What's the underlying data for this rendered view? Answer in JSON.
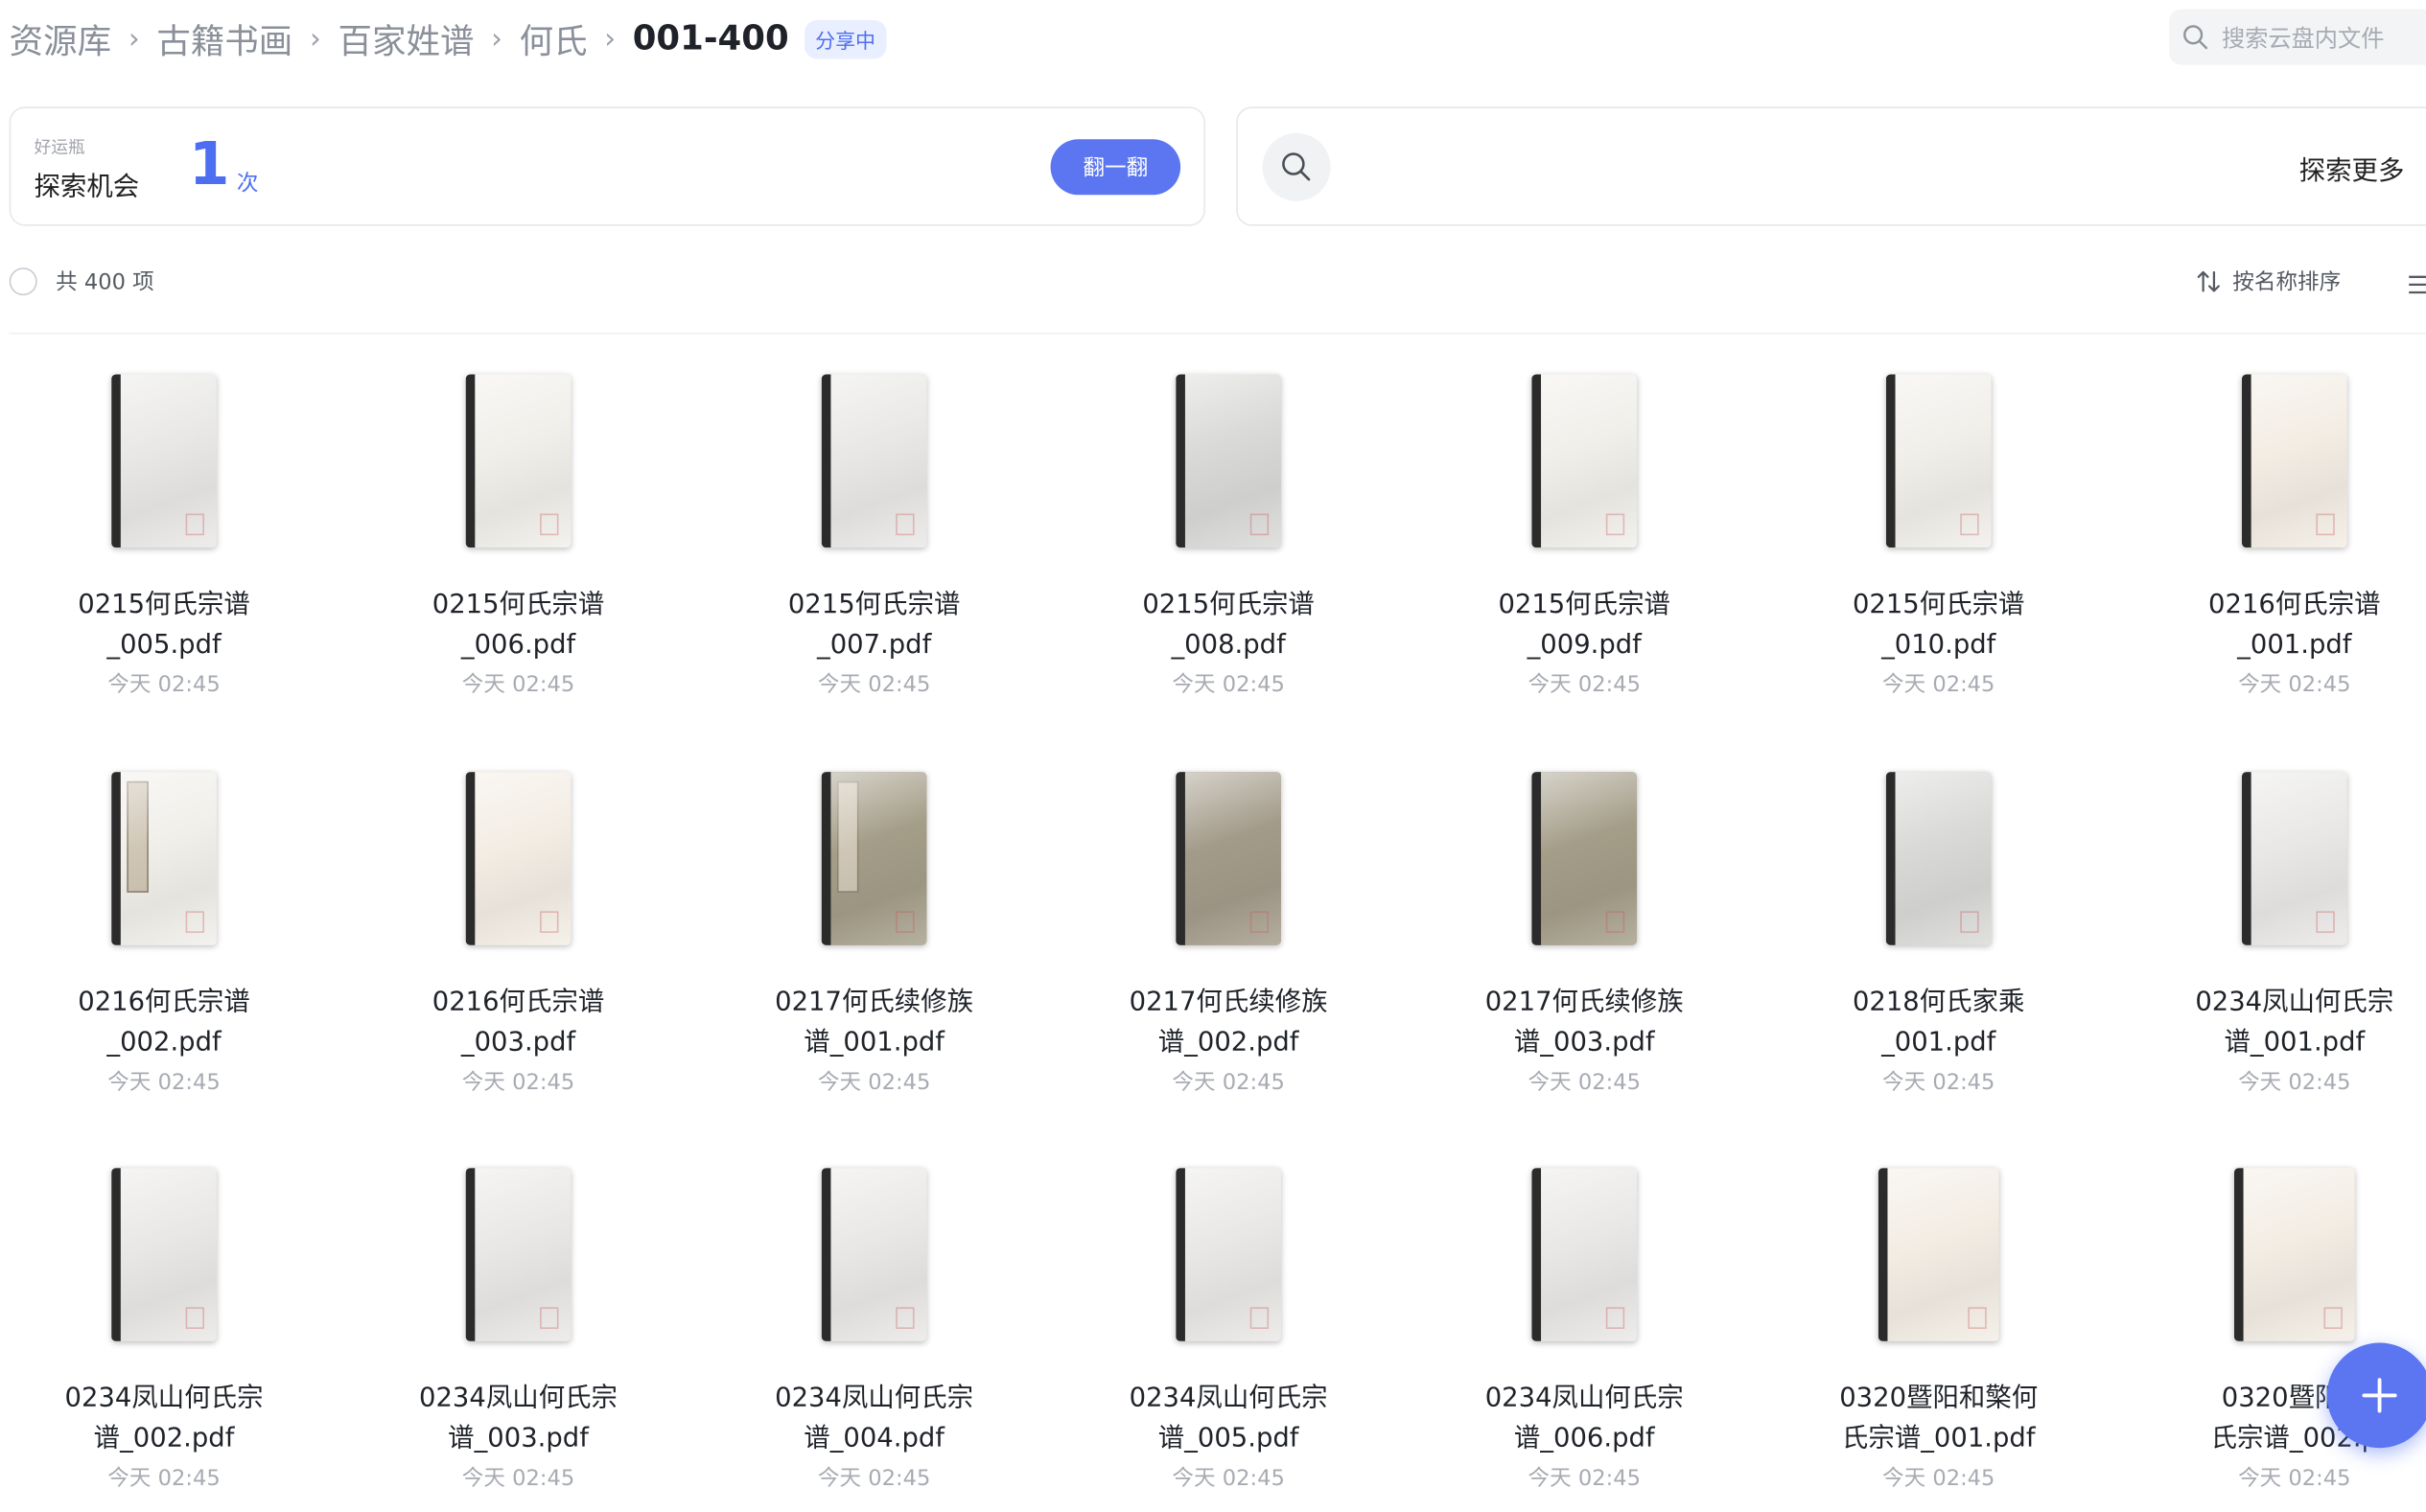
{
  "breadcrumb": {
    "items": [
      "资源库",
      "古籍书画",
      "百家姓谱",
      "何氏"
    ],
    "current": "001-400",
    "badge": "分享中",
    "separator": "›"
  },
  "search": {
    "placeholder": "搜索云盘内文件"
  },
  "lucky_card": {
    "small_label": "好运瓶",
    "label": "探索机会",
    "count": "1",
    "unit": "次",
    "button_label": "翻一翻"
  },
  "explore_card": {
    "label": "探索更多"
  },
  "list_header": {
    "count_text": "共 400 项",
    "sort_label": "按名称排序"
  },
  "files": [
    {
      "line1": "0215何氏宗谱",
      "line2": "_005.pdf",
      "date": "今天 02:45"
    },
    {
      "line1": "0215何氏宗谱",
      "line2": "_006.pdf",
      "date": "今天 02:45"
    },
    {
      "line1": "0215何氏宗谱",
      "line2": "_007.pdf",
      "date": "今天 02:45"
    },
    {
      "line1": "0215何氏宗谱",
      "line2": "_008.pdf",
      "date": "今天 02:45"
    },
    {
      "line1": "0215何氏宗谱",
      "line2": "_009.pdf",
      "date": "今天 02:45"
    },
    {
      "line1": "0215何氏宗谱",
      "line2": "_010.pdf",
      "date": "今天 02:45"
    },
    {
      "line1": "0216何氏宗谱",
      "line2": "_001.pdf",
      "date": "今天 02:45"
    },
    {
      "line1": "0216何氏宗谱",
      "line2": "_002.pdf",
      "date": "今天 02:45"
    },
    {
      "line1": "0216何氏宗谱",
      "line2": "_003.pdf",
      "date": "今天 02:45"
    },
    {
      "line1": "0217何氏续修族",
      "line2": "谱_001.pdf",
      "date": "今天 02:45"
    },
    {
      "line1": "0217何氏续修族",
      "line2": "谱_002.pdf",
      "date": "今天 02:45"
    },
    {
      "line1": "0217何氏续修族",
      "line2": "谱_003.pdf",
      "date": "今天 02:45"
    },
    {
      "line1": "0218何氏家乘",
      "line2": "_001.pdf",
      "date": "今天 02:45"
    },
    {
      "line1": "0234凤山何氏宗",
      "line2": "谱_001.pdf",
      "date": "今天 02:45"
    },
    {
      "line1": "0234凤山何氏宗",
      "line2": "谱_002.pdf",
      "date": "今天 02:45"
    },
    {
      "line1": "0234凤山何氏宗",
      "line2": "谱_003.pdf",
      "date": "今天 02:45"
    },
    {
      "line1": "0234凤山何氏宗",
      "line2": "谱_004.pdf",
      "date": "今天 02:45"
    },
    {
      "line1": "0234凤山何氏宗",
      "line2": "谱_005.pdf",
      "date": "今天 02:45"
    },
    {
      "line1": "0234凤山何氏宗",
      "line2": "谱_006.pdf",
      "date": "今天 02:45"
    },
    {
      "line1": "0320暨阳和檠何",
      "line2": "氏宗谱_001.pdf",
      "date": "今天 02:45"
    },
    {
      "line1": "0320暨阳和",
      "line2": "氏宗谱_002.p",
      "date": "今天 02:45"
    }
  ],
  "colors": {
    "accent": "#4e6ef2",
    "button": "#5b76f0",
    "text": "#1f2329",
    "muted": "#a7abb2"
  }
}
